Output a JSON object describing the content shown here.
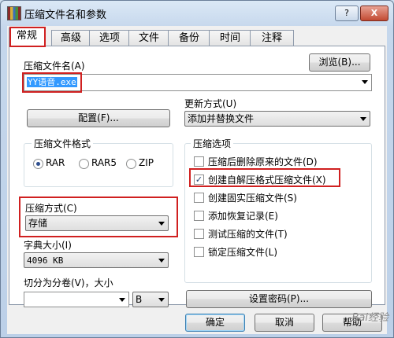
{
  "window": {
    "title": "压缩文件名和参数",
    "help_btn": "?",
    "close_btn": "X"
  },
  "tabs": [
    {
      "label": "常规"
    },
    {
      "label": "高级"
    },
    {
      "label": "选项"
    },
    {
      "label": "文件"
    },
    {
      "label": "备份"
    },
    {
      "label": "时间"
    },
    {
      "label": "注释"
    }
  ],
  "archive": {
    "name_label": "压缩文件名(A)",
    "name_value": "YY语音.exe",
    "browse_label": "浏览(B)..."
  },
  "update": {
    "label": "更新方式(U)",
    "value": "添加并替换文件"
  },
  "profile_label": "配置(F)...",
  "format": {
    "group_label": "压缩文件格式",
    "options": [
      {
        "label": "RAR",
        "selected": true
      },
      {
        "label": "RAR5",
        "selected": false
      },
      {
        "label": "ZIP",
        "selected": false
      }
    ]
  },
  "method": {
    "label": "压缩方式(C)",
    "value": "存储"
  },
  "dict": {
    "label": "字典大小(I)",
    "value": "4096 KB"
  },
  "split": {
    "label": "切分为分卷(V)，大小",
    "value": "",
    "unit": "B"
  },
  "options": {
    "group_label": "压缩选项",
    "items": [
      {
        "label": "压缩后删除原来的文件(D)",
        "checked": false
      },
      {
        "label": "创建自解压格式压缩文件(X)",
        "checked": true
      },
      {
        "label": "创建固实压缩文件(S)",
        "checked": false
      },
      {
        "label": "添加恢复记录(E)",
        "checked": false
      },
      {
        "label": "测试压缩的文件(T)",
        "checked": false
      },
      {
        "label": "锁定压缩文件(L)",
        "checked": false
      }
    ]
  },
  "password_label": "设置密码(P)...",
  "footer": {
    "ok": "确定",
    "cancel": "取消",
    "help": "帮助"
  },
  "watermark": "Bai经验"
}
